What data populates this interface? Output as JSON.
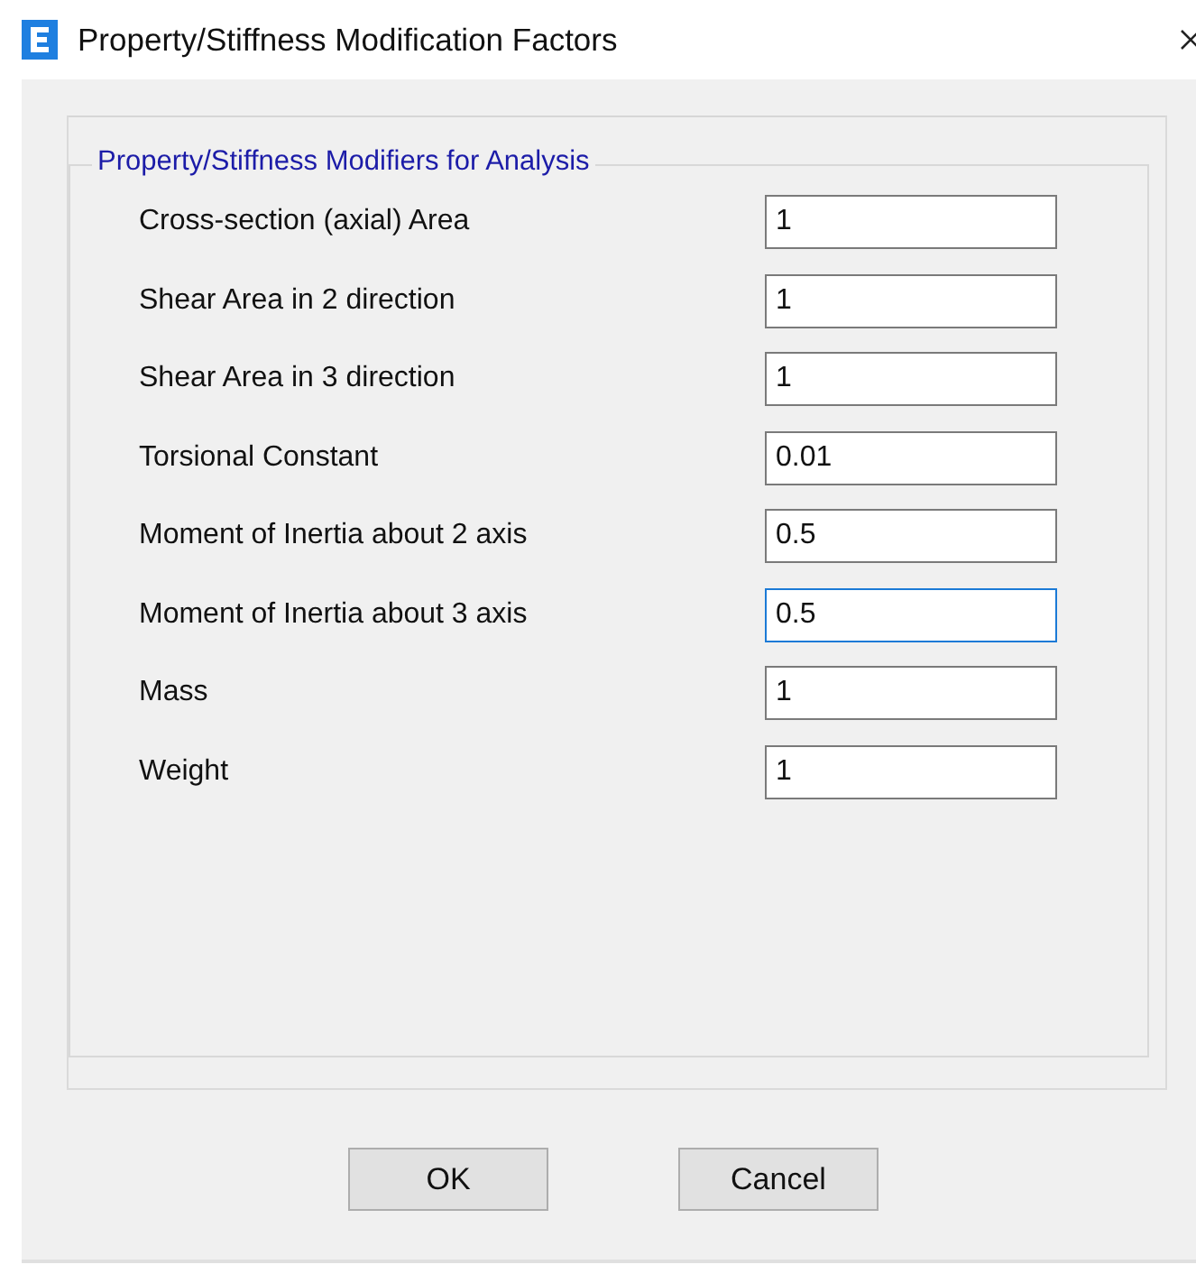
{
  "window": {
    "title": "Property/Stiffness Modification Factors"
  },
  "group": {
    "title": "Property/Stiffness Modifiers for Analysis"
  },
  "fields": [
    {
      "label": "Cross-section (axial) Area",
      "value": "1",
      "focused": false
    },
    {
      "label": "Shear Area in 2 direction",
      "value": "1",
      "focused": false
    },
    {
      "label": "Shear Area in 3 direction",
      "value": "1",
      "focused": false
    },
    {
      "label": "Torsional Constant",
      "value": "0.01",
      "focused": false
    },
    {
      "label": "Moment of Inertia about 2 axis",
      "value": "0.5",
      "focused": false
    },
    {
      "label": "Moment of Inertia about 3 axis",
      "value": "0.5",
      "focused": true
    },
    {
      "label": "Mass",
      "value": "1",
      "focused": false
    },
    {
      "label": "Weight",
      "value": "1",
      "focused": false
    }
  ],
  "buttons": [
    "OK",
    "Cancel"
  ]
}
